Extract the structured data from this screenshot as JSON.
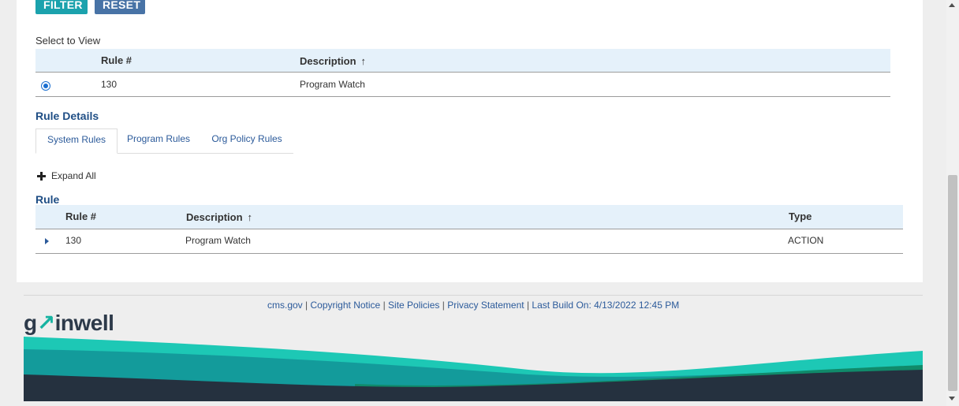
{
  "buttons": {
    "filter": "FILTER",
    "reset": "RESET"
  },
  "select_to_view": {
    "label": "Select to View",
    "columns": [
      "Rule #",
      "Description"
    ],
    "sort_arrow": "↑",
    "rows": [
      {
        "rule": "130",
        "description": "Program Watch",
        "selected": true
      }
    ]
  },
  "rule_details": {
    "label": "Rule Details",
    "tabs": [
      "System Rules",
      "Program Rules",
      "Org Policy Rules"
    ],
    "active_tab": "System Rules"
  },
  "expand_all": "Expand All",
  "rule_table": {
    "label": "Rule",
    "columns": [
      "Rule #",
      "Description",
      "Type"
    ],
    "sort_arrow": "↑",
    "rows": [
      {
        "rule": "130",
        "description": "Program Watch",
        "type": "ACTION"
      }
    ]
  },
  "footer": {
    "links": [
      "cms.gov",
      "Copyright Notice",
      "Site Policies",
      "Privacy Statement"
    ],
    "separator": "|",
    "last_build": "Last Build On: 4/13/2022 12:45 PM",
    "logo_prefix": "g",
    "logo_mark": "↗",
    "logo_suffix": "inwell"
  },
  "colors": {
    "filter_button": "#1ba2ad",
    "reset_button": "#4873a6",
    "table_header": "#e5f1fa",
    "link": "#2b5a9a",
    "section_label": "#1f4e85"
  }
}
